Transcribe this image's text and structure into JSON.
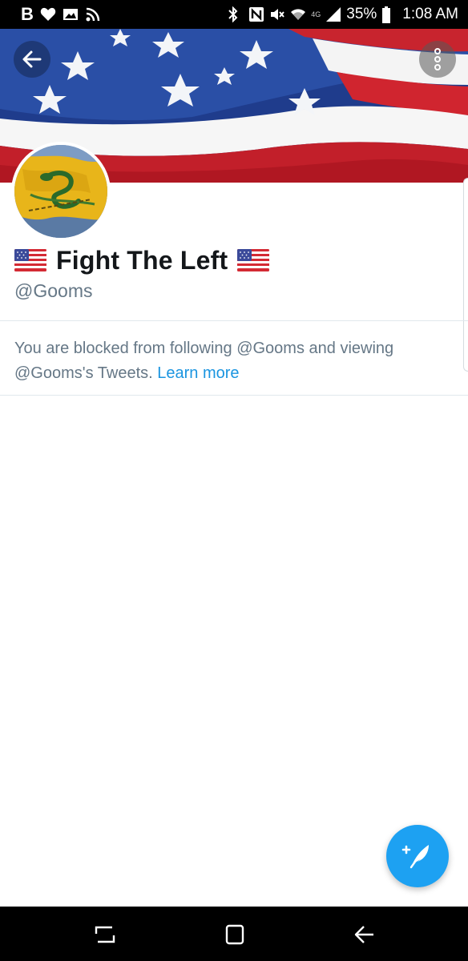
{
  "status_bar": {
    "app_letter": "B",
    "network_label": "4G",
    "battery_percent": "35%",
    "time": "1:08 AM"
  },
  "profile": {
    "display_name": "Fight The Left",
    "handle": "@Gooms",
    "blocked_text": "You are blocked from following @Gooms and viewing @Gooms's Tweets.",
    "learn_more_label": "Learn more"
  },
  "colors": {
    "accent": "#1da1f2",
    "link": "#1b95e0",
    "text_primary": "#14171a",
    "text_secondary": "#657786"
  },
  "icons": {
    "back": "arrow-left-icon",
    "more": "more-vertical-icon",
    "compose": "compose-tweet-icon",
    "nav_recents": "recent-apps-icon",
    "nav_home": "home-icon",
    "nav_back": "nav-back-icon"
  }
}
